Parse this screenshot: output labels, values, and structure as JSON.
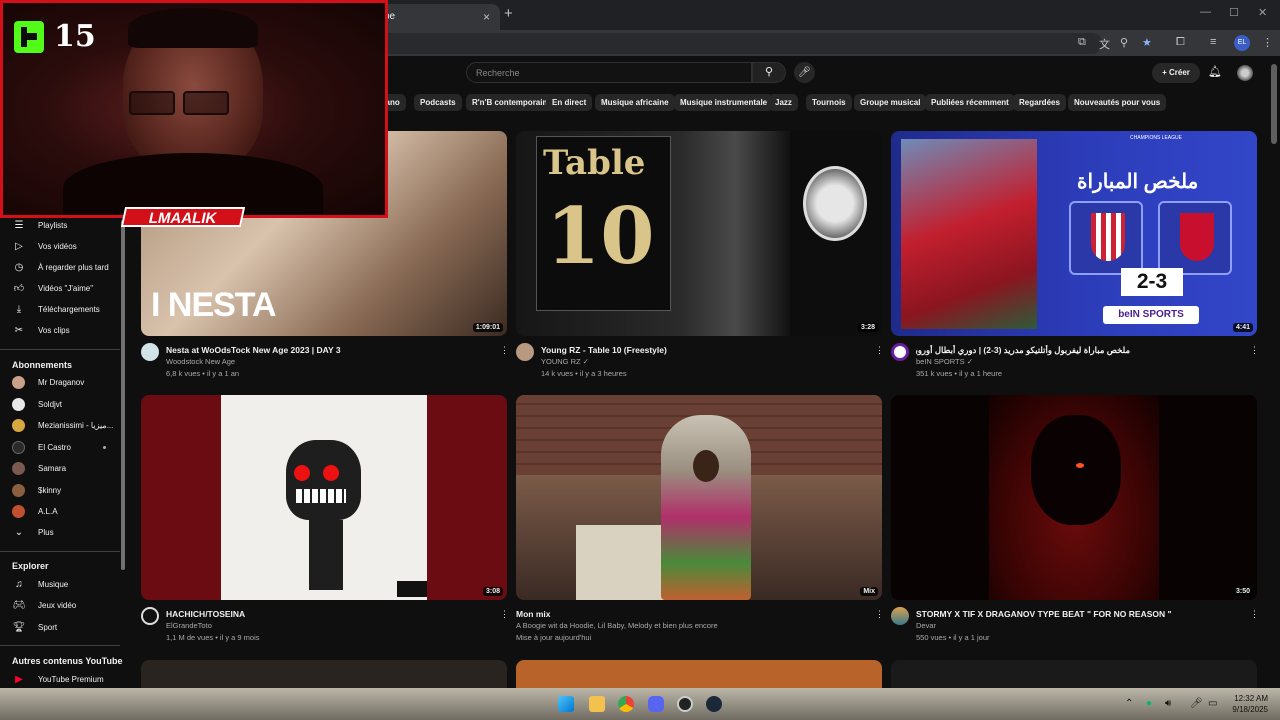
{
  "browser": {
    "tab_title": "be",
    "tab_close": "×",
    "new_tab": "+",
    "profile_initials": "EL"
  },
  "header": {
    "search_placeholder": "Recherche",
    "create_label": "Créer"
  },
  "chips": [
    "Piano",
    "Podcasts",
    "R'n'B contemporain",
    "En direct",
    "Musique africaine",
    "Musique instrumentale",
    "Jazz",
    "Tournois",
    "Groupe musical",
    "Publiées récemment",
    "Regardées",
    "Nouveautés pour vous"
  ],
  "sidebar": {
    "you_items": [
      {
        "label": "Playlists",
        "icon": "playlist-icon"
      },
      {
        "label": "Vos vidéos",
        "icon": "video-icon"
      },
      {
        "label": "À regarder plus tard",
        "icon": "clock-icon"
      },
      {
        "label": "Vidéos \"J'aime\"",
        "icon": "thumbs-up-icon"
      },
      {
        "label": "Téléchargements",
        "icon": "download-icon"
      },
      {
        "label": "Vos clips",
        "icon": "scissors-icon"
      }
    ],
    "subs_heading": "Abonnements",
    "subs": [
      {
        "label": "Mr Draganov",
        "color": "#c9a08a",
        "dot": false
      },
      {
        "label": "Soldjvt",
        "color": "#e8e8e8",
        "dot": false
      },
      {
        "label": "Mezianissimi - ميزيا...",
        "color": "#d8a840",
        "dot": false
      },
      {
        "label": "El Castro",
        "color": "#2a2a2a",
        "dot": true
      },
      {
        "label": "Samara",
        "color": "#7a5a50",
        "dot": false
      },
      {
        "label": "$kinny",
        "color": "#8a6040",
        "dot": false
      },
      {
        "label": "A.L.A",
        "color": "#c05030",
        "dot": false
      },
      {
        "label": "Plus",
        "color": "",
        "dot": false
      }
    ],
    "explore_heading": "Explorer",
    "explore": [
      {
        "label": "Musique",
        "icon": "music-icon"
      },
      {
        "label": "Jeux vidéo",
        "icon": "gamepad-icon"
      },
      {
        "label": "Sport",
        "icon": "trophy-icon"
      }
    ],
    "other_heading": "Autres contenus YouTube",
    "other": [
      {
        "label": "YouTube Premium",
        "icon": "youtube-icon"
      }
    ]
  },
  "videos": [
    {
      "title": "Nesta at WoOdsTock New Age 2023 | DAY 3",
      "channel": "Woodstock New Age",
      "stats": "6,8 k vues • il y a 1 an",
      "duration": "1:09:01",
      "thumb_text": "I NESTA"
    },
    {
      "title": "Young RZ - Table 10 (Freestyle)",
      "channel": "YOUNG RZ ✓",
      "stats": "14 k vues • il y a 3 heures",
      "duration": "3:28",
      "thumb_text_1": "Table",
      "thumb_text_2": "10"
    },
    {
      "title": "ملخص مباراة ليفربول وأتلتيكو مدريد (3-2) | دوري أبطال أوروبا - الجولة 1",
      "channel": "beIN SPORTS ✓",
      "stats": "351 k vues • il y a 1 heure",
      "duration": "4:41",
      "thumb_text_1": "ملخص المباراة",
      "thumb_score": "2-3",
      "thumb_brand": "beIN SPORTS",
      "thumb_badge": "CHAMPIONS LEAGUE"
    },
    {
      "title": "HACHICH/TOSEINA",
      "channel": "ElGrandeToto",
      "stats": "1,1 M de vues • il y a 9 mois",
      "duration": "3:08"
    },
    {
      "title": "Mon mix",
      "channel": "A Boogie wit da Hoodie, Lil Baby, Melody et bien plus encore",
      "stats": "Mise à jour aujourd'hui",
      "duration": "Mix"
    },
    {
      "title": "STORMY X TIF X DRAGANOV TYPE BEAT \" FOR NO REASON \"",
      "channel": "Devar",
      "stats": "550 vues • il y a 1 jour",
      "duration": "3:50"
    }
  ],
  "overlay": {
    "kick_number": "15",
    "streamer_name": "LMAALIK"
  },
  "taskbar": {
    "time": "12:32 AM",
    "date": "9/18/2025"
  }
}
